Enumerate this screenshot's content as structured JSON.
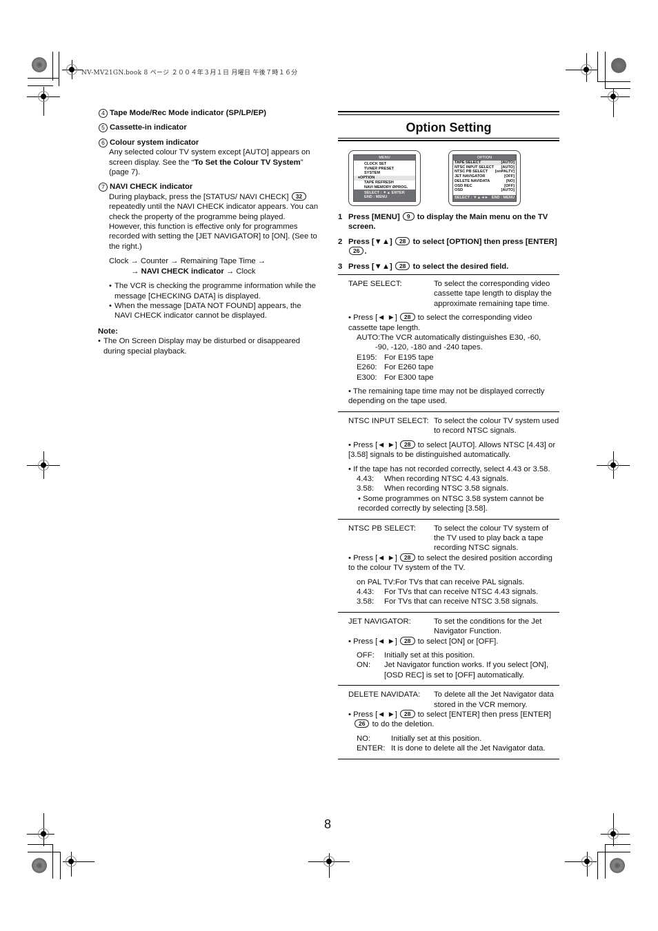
{
  "print_header": "NV-MV21GN.book  8 ページ  ２００４年３月１日  月曜日  午後７時１６分",
  "page_number": "8",
  "left": {
    "items": [
      {
        "num": "4",
        "title": "Tape Mode/Rec Mode indicator (SP/LP/EP)"
      },
      {
        "num": "5",
        "title": "Cassette-in indicator"
      },
      {
        "num": "6",
        "title": "Colour system indicator",
        "body_pre": "Any selected colour TV system except [AUTO] appears on screen display. See the “",
        "body_bold": "To Set the Colour TV System",
        "body_post": "” (page 7)."
      },
      {
        "num": "7",
        "title": "NAVI CHECK indicator",
        "body_pre": "During playback, press the [STATUS/ NAVI CHECK]",
        "button": "32",
        "body_post": "repeatedly until the NAVI CHECK indicator appears. You can check the property of the programme being played. However, this function is effective only for programmes recorded with setting the [JET NAVIGATOR] to [ON]. (See to the right.)"
      }
    ],
    "sequence": {
      "line1": "Clock → Counter → Remaining Tape Time →",
      "arrow": "→ ",
      "bold": "NAVI CHECK indicator",
      "tail": " → Clock"
    },
    "bullets": [
      "The VCR is checking the programme information while the message [CHECKING DATA] is displayed.",
      "When the message [DATA NOT FOUND] appears, the NAVI CHECK indicator cannot be displayed."
    ],
    "note_title": "Note:",
    "note_bullets": [
      "The On Screen Display may be disturbed or disappeared during special playback."
    ]
  },
  "right": {
    "title": "Option Setting",
    "menu_screen": {
      "title": "MENU",
      "items": [
        "CLOCK SET",
        "TUNER PRESET",
        "SYSTEM",
        "♦OPTION",
        "TAPE REFRESH",
        "NAVI MEMORY ØPROG."
      ],
      "selected_index": 3,
      "footer1": "SELECT : ▼▲  ENTER",
      "footer2": "END      : MENU"
    },
    "option_screen": {
      "title": "OPTION",
      "rows": [
        {
          "label": "TAPE SELECT",
          "value": "[AUTO]"
        },
        {
          "label": "NTSC INPUT SELECT",
          "value": "[AUTO]"
        },
        {
          "label": "NTSC PB SELECT",
          "value": "[onPALTV]"
        },
        {
          "label": "JET NAVIGATOR",
          "value": "[OFF]"
        },
        {
          "label": "DELETE NAVIDATA",
          "value": "[NO]"
        },
        {
          "label": "OSD REC",
          "value": "[OFF]"
        },
        {
          "label": "OSD",
          "value": "[AUTO]"
        }
      ],
      "footer_left": "SELECT : ▼▲◄►",
      "footer_right": "END : MENU"
    },
    "steps": [
      {
        "num": "1",
        "pre": "Press [MENU]",
        "btn": "9",
        "post": "to display the Main menu on the TV screen."
      },
      {
        "num": "2",
        "pre": "Press [▼▲]",
        "btn": "28",
        "post": "to select [OPTION] then press [ENTER]",
        "btn2": "26",
        "post2": "."
      },
      {
        "num": "3",
        "pre": "Press [▼▲]",
        "btn": "28",
        "post": "to select the desired field."
      }
    ],
    "sections": {
      "tape_select": {
        "term": "TAPE SELECT:",
        "desc": "To select the corresponding video cassette tape length to display the approximate remaining tape time.",
        "press_pre": "• Press [◄ ►]",
        "press_btn": "28",
        "press_post": "to select the corresponding video cassette tape length.",
        "auto": "AUTO:The VCR automatically distinguishes E30, -60,",
        "auto2": "-90, -120, -180 and -240 tapes.",
        "opts": [
          {
            "k": "E195:",
            "v": "For E195 tape"
          },
          {
            "k": "E260:",
            "v": "For E260 tape"
          },
          {
            "k": "E300:",
            "v": "For E300 tape"
          }
        ],
        "note": "• The remaining tape time may not be displayed correctly depending on the tape used."
      },
      "ntsc_input": {
        "term": "NTSC INPUT SELECT:",
        "desc": "To select the colour TV system used to record NTSC signals.",
        "press_pre": "• Press [◄ ►]",
        "press_btn": "28",
        "press_post": "to select [AUTO]. Allows NTSC [4.43] or [3.58] signals to be distinguished automatically.",
        "if_text": "• If the tape has not recorded correctly, select 4.43 or 3.58.",
        "opts": [
          {
            "k": "4.43:",
            "v": "When recording NTSC 4.43 signals."
          },
          {
            "k": "3.58:",
            "v": "When recording NTSC 3.58 signals."
          }
        ],
        "note": "• Some programmes on NTSC 3.58 system cannot be recorded correctly by selecting [3.58]."
      },
      "ntsc_pb": {
        "term": "NTSC PB SELECT:",
        "desc": "To select the colour TV system of the TV used to play back a tape recording NTSC signals.",
        "press_pre": "• Press [◄ ►]",
        "press_btn": "28",
        "press_post": "to select the desired position according to the colour TV system of the TV.",
        "onpal": "on PAL TV:For TVs that can receive PAL signals.",
        "opts": [
          {
            "k": "4.43:",
            "v": "For TVs that can receive NTSC 4.43 signals."
          },
          {
            "k": "3.58:",
            "v": "For TVs that can receive NTSC 3.58 signals."
          }
        ]
      },
      "jet_nav": {
        "term": "JET NAVIGATOR:",
        "desc": "To set the conditions for the Jet Navigator Function.",
        "press_pre": "• Press [◄ ►]",
        "press_btn": "28",
        "press_post": "to select [ON] or [OFF].",
        "opts": [
          {
            "k": "OFF:",
            "v": "Initially set at this position."
          },
          {
            "k": "ON:",
            "v": "Jet Navigator function works. If you select [ON], [OSD REC] is set to [OFF] automatically."
          }
        ]
      },
      "delete_nav": {
        "term": "DELETE NAVIDATA:",
        "desc": "To delete all the Jet Navigator data stored in the VCR memory.",
        "press_pre": "• Press [◄ ►]",
        "press_btn": "28",
        "press_post": "to select [ENTER] then press [ENTER]",
        "press_btn2": "26",
        "press_post2": "to do the deletion.",
        "opts": [
          {
            "k": "NO:",
            "v": "Initially set at this position."
          },
          {
            "k": "ENTER:",
            "v": "It is done to delete all the Jet Navigator data."
          }
        ]
      }
    }
  }
}
